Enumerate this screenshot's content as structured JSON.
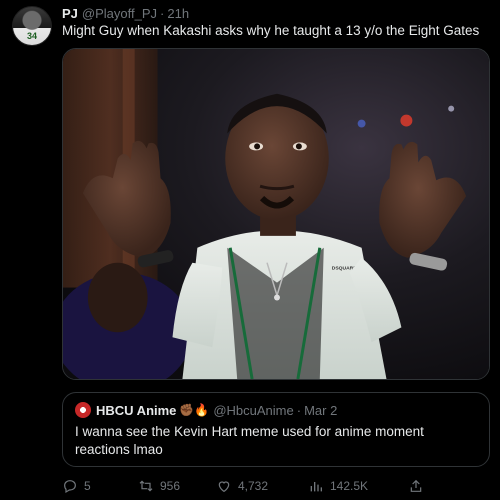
{
  "tweet": {
    "author_name": "PJ",
    "author_handle": "@Playoff_PJ",
    "separator": "·",
    "time": "21h",
    "avatar_jersey_number": "34",
    "text": "Might Guy when Kakashi asks why he taught a 13 y/o the Eight Gates"
  },
  "media": {
    "shirt_logo_text": "DSQUARED"
  },
  "quote": {
    "author_name": "HBCU Anime",
    "emoji": "✊🏾🔥",
    "author_handle": "@HbcuAnime",
    "separator": "·",
    "date": "Mar 2",
    "text": "I wanna see the Kevin Hart meme used for anime moment reactions lmao"
  },
  "actions": {
    "replies": "5",
    "retweets": "956",
    "likes": "4,732",
    "views": "142.5K"
  },
  "icons": [
    "reply-icon",
    "retweet-icon",
    "like-icon",
    "views-icon",
    "share-icon"
  ],
  "colors": {
    "background": "#000000",
    "text_primary": "#e7e9ea",
    "text_secondary": "#71767b",
    "border": "#2f3336"
  }
}
